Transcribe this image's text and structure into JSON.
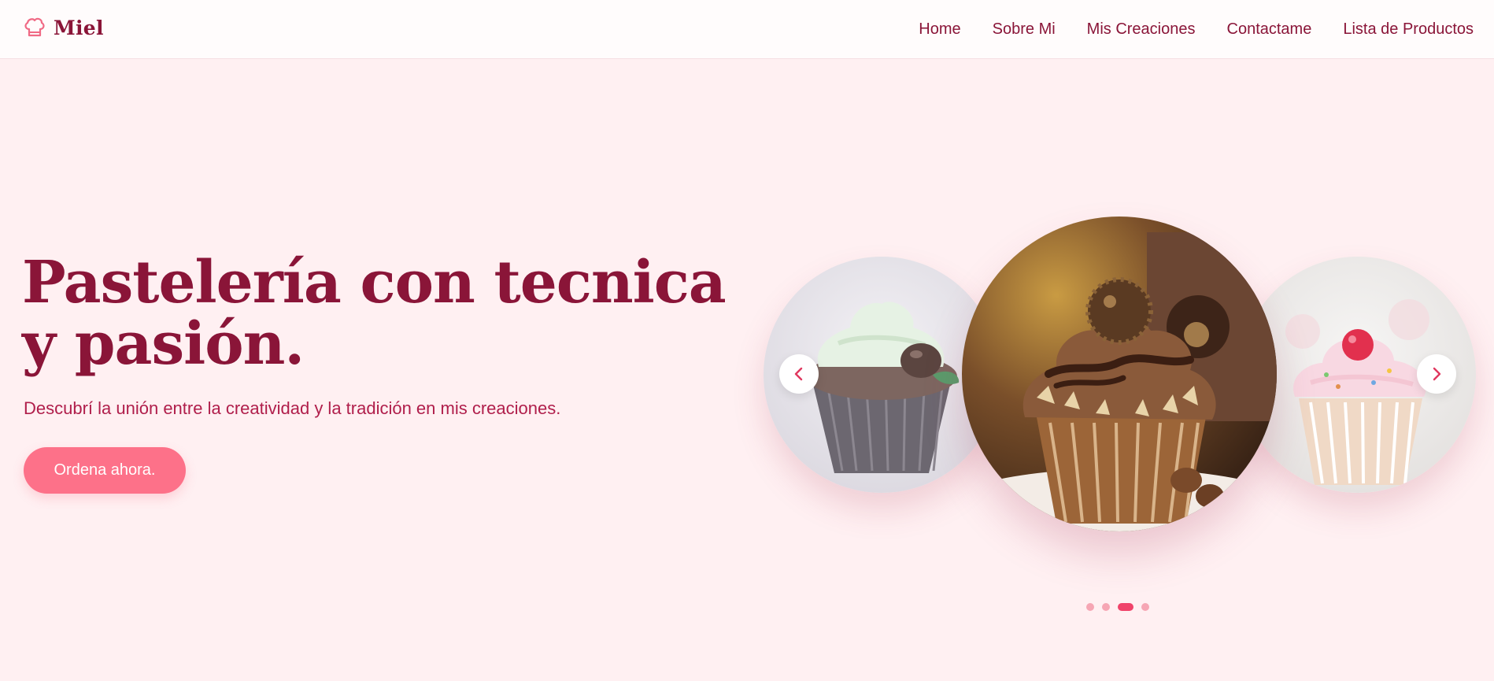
{
  "brand": {
    "name": "Miel",
    "icon": "chef-hat-icon"
  },
  "nav": {
    "items": [
      {
        "label": "Home"
      },
      {
        "label": "Sobre Mi"
      },
      {
        "label": "Mis Creaciones"
      },
      {
        "label": "Contactame"
      },
      {
        "label": "Lista de Productos"
      }
    ]
  },
  "hero": {
    "title_line1": "Pastelería con tecnica",
    "title_line2": "y pasión.",
    "subtitle": "Descubrí la unión entre la creatividad y la tradición en mis creaciones.",
    "cta_label": "Ordena ahora."
  },
  "carousel": {
    "slides": [
      {
        "image": "cupcake-mint-frosting-chocolate"
      },
      {
        "image": "cupcake-chocolate-hazelnut-ferrero"
      },
      {
        "image": "cupcake-pink-frosting-cherry"
      }
    ],
    "prev_icon": "chevron-left-icon",
    "next_icon": "chevron-right-icon",
    "dot_count": 4,
    "active_dot": 3
  },
  "colors": {
    "page_bg": "#fff0f2",
    "header_bg": "#fffcfc",
    "brand": "#8a1538",
    "subtitle": "#b01e4b",
    "cta": "#fd7189",
    "dot": "#f6a6b4",
    "dot_active": "#f0436a"
  }
}
